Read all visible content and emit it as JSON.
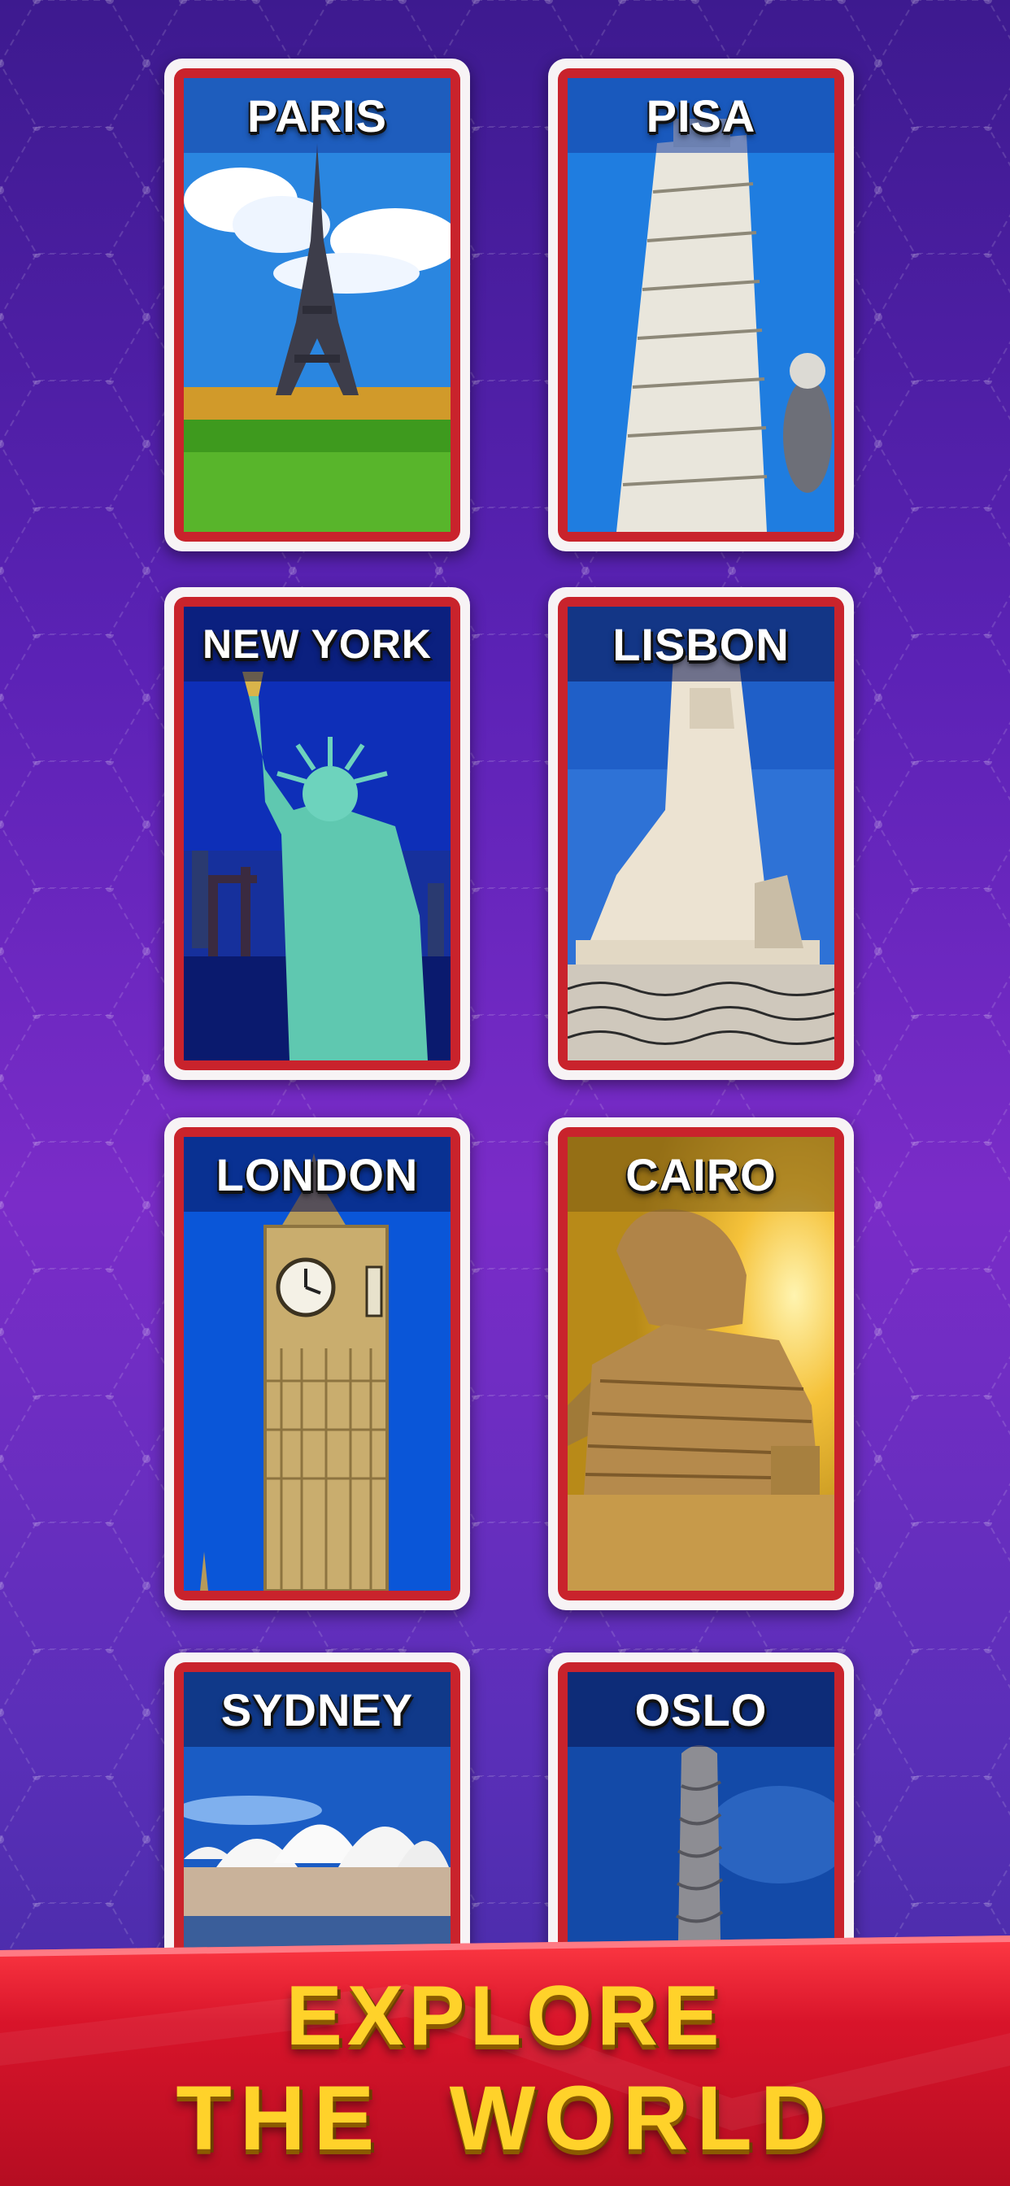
{
  "cards": [
    {
      "id": "paris",
      "title": "PARIS",
      "band_color": "#1d4ea8"
    },
    {
      "id": "pisa",
      "title": "PISA",
      "band_color": "#1d4ea8"
    },
    {
      "id": "new_york",
      "title": "NEW YORK",
      "band_color": "#0f1f66"
    },
    {
      "id": "lisbon",
      "title": "LISBON",
      "band_color": "#0f2b6a"
    },
    {
      "id": "london",
      "title": "LONDON",
      "band_color": "#0b2a7a"
    },
    {
      "id": "cairo",
      "title": "CAIRO",
      "band_color": "#9a7a1a"
    },
    {
      "id": "sydney",
      "title": "SYDNEY",
      "band_color": "#14306e"
    },
    {
      "id": "oslo",
      "title": "OSLO",
      "band_color": "#0f2b6a"
    }
  ],
  "banner": {
    "line1": "EXPLORE",
    "line2": "THE  WORLD"
  },
  "colors": {
    "card_border": "#c9232c",
    "banner_red": "#d21a2a",
    "banner_text": "#ffd22a",
    "bg_purple": "#6a28c0"
  }
}
